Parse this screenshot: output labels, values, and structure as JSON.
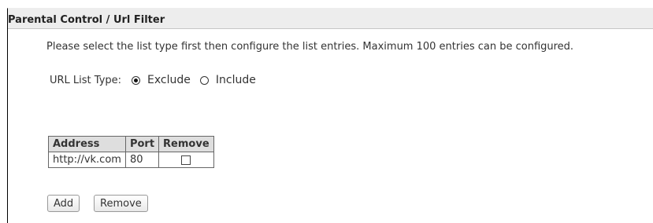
{
  "panel": {
    "title": "Parental Control / Url Filter",
    "description": "Please select the list type first then configure the list entries. Maximum 100 entries can be configured."
  },
  "url_list_type": {
    "label": "URL List Type:",
    "options": [
      {
        "label": "Exclude",
        "selected": true
      },
      {
        "label": "Include",
        "selected": false
      }
    ]
  },
  "table": {
    "headers": [
      "Address",
      "Port",
      "Remove"
    ],
    "rows": [
      {
        "address": "http://vk.com",
        "port": "80",
        "remove_checked": false
      }
    ]
  },
  "buttons": {
    "add_label": "Add",
    "remove_label": "Remove"
  }
}
